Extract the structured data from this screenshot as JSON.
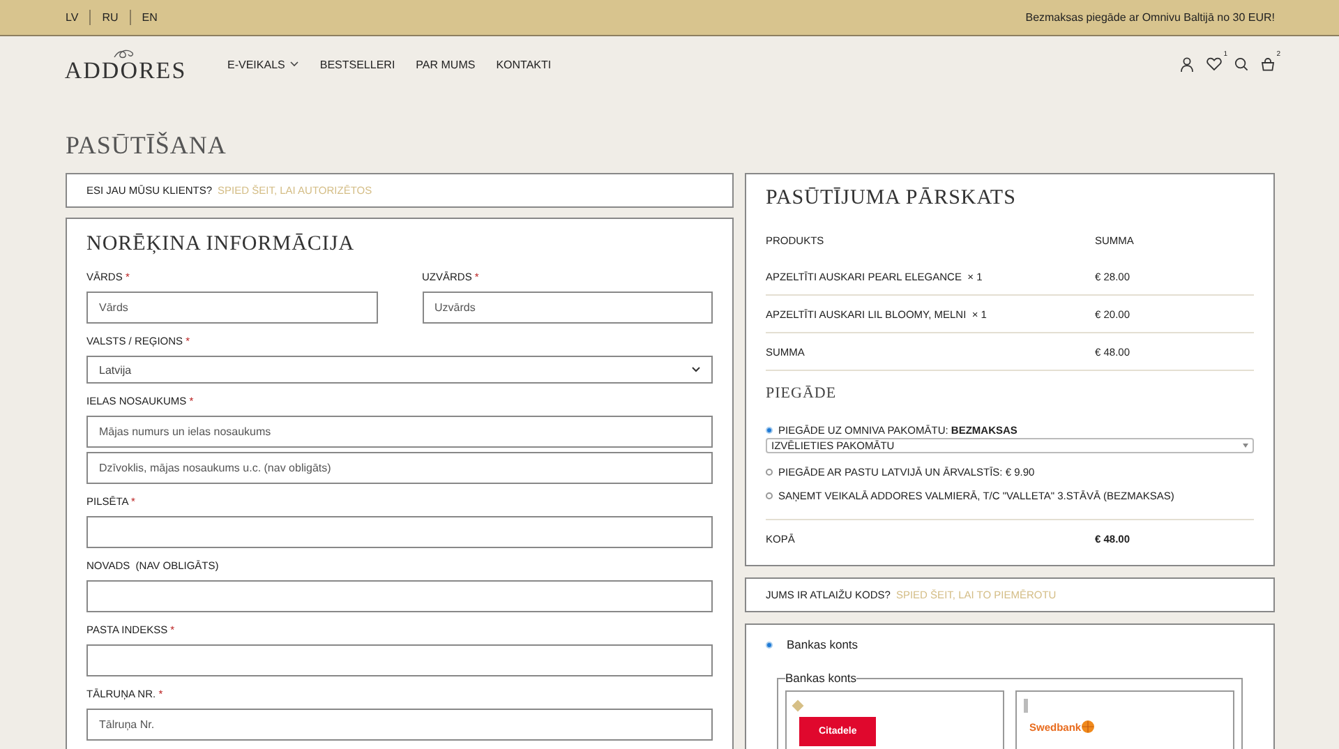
{
  "top_bar": {
    "languages": [
      "LV",
      "RU",
      "EN"
    ],
    "announcement": "Bezmaksas piegāde ar Omnivu Baltijā no 30 EUR!"
  },
  "header": {
    "logo": "ADDORES",
    "nav": [
      {
        "label": "E-VEIKALS",
        "dropdown": true
      },
      {
        "label": "BESTSELLERI",
        "dropdown": false
      },
      {
        "label": "PAR MUMS",
        "dropdown": false
      },
      {
        "label": "KONTAKTI",
        "dropdown": false
      }
    ],
    "wishlist_count": "1",
    "cart_count": "2"
  },
  "page_title": "PASŪTĪŠANA",
  "login_notice": {
    "text": "ESI JAU MŪSU KLIENTS?",
    "link": "SPIED ŠEIT, LAI AUTORIZĒTOS"
  },
  "billing": {
    "title": "NORĒĶINA INFORMĀCIJA",
    "rows": [
      [
        {
          "kind": "text",
          "label": "VĀRDS",
          "required_mark": "*",
          "inputs": [
            {
              "placeholder": "Vārds"
            }
          ]
        },
        {
          "kind": "text",
          "label": "UZVĀRDS",
          "required_mark": "*",
          "inputs": [
            {
              "placeholder": "Uzvārds"
            }
          ]
        }
      ],
      [
        {
          "kind": "select",
          "label": "VALSTS / REĢIONS",
          "required_mark": "*",
          "value": "Latvija"
        }
      ],
      [
        {
          "kind": "text",
          "label": "IELAS NOSAUKUMS",
          "required_mark": "*",
          "inputs": [
            {
              "placeholder": "Mājas numurs un ielas nosaukums"
            },
            {
              "placeholder": "Dzīvoklis, mājas nosaukums u.c. (nav obligāts)"
            }
          ]
        }
      ],
      [
        {
          "kind": "blank",
          "label": "PILSĒTA",
          "required_mark": "*"
        }
      ],
      [
        {
          "kind": "blank",
          "label": "NOVADS  (NAV OBLIGĀTS)"
        }
      ],
      [
        {
          "kind": "blank",
          "label": "PASTA INDEKSS",
          "required_mark": "*"
        }
      ],
      [
        {
          "kind": "text",
          "label": "TĀLRUŅA NR.",
          "required_mark": "*",
          "inputs": [
            {
              "placeholder": "Tālruņa Nr."
            }
          ]
        }
      ]
    ]
  },
  "review": {
    "title": "PASŪTĪJUMA PĀRSKATS",
    "columns": [
      "PRODUKTS",
      "SUMMA"
    ],
    "items": [
      {
        "name": "APZELTĪTI AUSKARI PEARL ELEGANCE",
        "qty": "× 1",
        "price": "€ 28.00"
      },
      {
        "name": "APZELTĪTI AUSKARI LIL BLOOMY, MELNI",
        "qty": "× 1",
        "price": "€ 20.00"
      }
    ],
    "subtotal": {
      "label": "SUMMA",
      "value": "€ 48.00"
    },
    "shipping": {
      "title": "PIEGĀDE",
      "options": [
        {
          "label": "PIEGĀDE UZ OMNIVA PAKOMĀTU: **BEZMAKSAS**",
          "selected": true,
          "select_placeholder": "IZVĒLIETIES PAKOMĀTU"
        },
        {
          "label": "PIEGĀDE AR PASTU LATVIJĀ UN ĀRVALSTĪS: € 9.90",
          "selected": false
        },
        {
          "label": "SAŅEMT VEIKALĀ ADDORES VALMIERĀ, T/C \"VALLETA\" 3.STĀVĀ (BEZMAKSAS)",
          "selected": false
        }
      ]
    },
    "total": {
      "label": "KOPĀ",
      "value": "€ 48.00"
    }
  },
  "coupon_notice": {
    "text": "JUMS IR ATLAIŽU KODS?",
    "link": "SPIED ŠEIT, LAI TO PIEMĒROTU"
  },
  "payment": {
    "methods": [
      {
        "label": "Bankas konts",
        "selected": true
      }
    ],
    "legend": "Bankas konts",
    "banks": [
      {
        "name": "Citadele",
        "kind": "citadele",
        "selected": true
      },
      {
        "name": "Swedbank",
        "kind": "swedbank",
        "selected": false
      }
    ]
  }
}
